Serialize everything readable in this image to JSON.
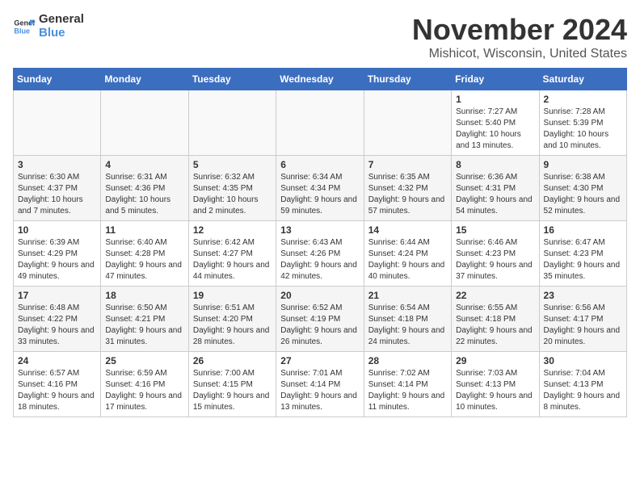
{
  "logo": {
    "line1": "General",
    "line2": "Blue"
  },
  "title": "November 2024",
  "location": "Mishicot, Wisconsin, United States",
  "weekdays": [
    "Sunday",
    "Monday",
    "Tuesday",
    "Wednesday",
    "Thursday",
    "Friday",
    "Saturday"
  ],
  "weeks": [
    [
      {
        "day": "",
        "info": ""
      },
      {
        "day": "",
        "info": ""
      },
      {
        "day": "",
        "info": ""
      },
      {
        "day": "",
        "info": ""
      },
      {
        "day": "",
        "info": ""
      },
      {
        "day": "1",
        "info": "Sunrise: 7:27 AM\nSunset: 5:40 PM\nDaylight: 10 hours and 13 minutes."
      },
      {
        "day": "2",
        "info": "Sunrise: 7:28 AM\nSunset: 5:39 PM\nDaylight: 10 hours and 10 minutes."
      }
    ],
    [
      {
        "day": "3",
        "info": "Sunrise: 6:30 AM\nSunset: 4:37 PM\nDaylight: 10 hours and 7 minutes."
      },
      {
        "day": "4",
        "info": "Sunrise: 6:31 AM\nSunset: 4:36 PM\nDaylight: 10 hours and 5 minutes."
      },
      {
        "day": "5",
        "info": "Sunrise: 6:32 AM\nSunset: 4:35 PM\nDaylight: 10 hours and 2 minutes."
      },
      {
        "day": "6",
        "info": "Sunrise: 6:34 AM\nSunset: 4:34 PM\nDaylight: 9 hours and 59 minutes."
      },
      {
        "day": "7",
        "info": "Sunrise: 6:35 AM\nSunset: 4:32 PM\nDaylight: 9 hours and 57 minutes."
      },
      {
        "day": "8",
        "info": "Sunrise: 6:36 AM\nSunset: 4:31 PM\nDaylight: 9 hours and 54 minutes."
      },
      {
        "day": "9",
        "info": "Sunrise: 6:38 AM\nSunset: 4:30 PM\nDaylight: 9 hours and 52 minutes."
      }
    ],
    [
      {
        "day": "10",
        "info": "Sunrise: 6:39 AM\nSunset: 4:29 PM\nDaylight: 9 hours and 49 minutes."
      },
      {
        "day": "11",
        "info": "Sunrise: 6:40 AM\nSunset: 4:28 PM\nDaylight: 9 hours and 47 minutes."
      },
      {
        "day": "12",
        "info": "Sunrise: 6:42 AM\nSunset: 4:27 PM\nDaylight: 9 hours and 44 minutes."
      },
      {
        "day": "13",
        "info": "Sunrise: 6:43 AM\nSunset: 4:26 PM\nDaylight: 9 hours and 42 minutes."
      },
      {
        "day": "14",
        "info": "Sunrise: 6:44 AM\nSunset: 4:24 PM\nDaylight: 9 hours and 40 minutes."
      },
      {
        "day": "15",
        "info": "Sunrise: 6:46 AM\nSunset: 4:23 PM\nDaylight: 9 hours and 37 minutes."
      },
      {
        "day": "16",
        "info": "Sunrise: 6:47 AM\nSunset: 4:23 PM\nDaylight: 9 hours and 35 minutes."
      }
    ],
    [
      {
        "day": "17",
        "info": "Sunrise: 6:48 AM\nSunset: 4:22 PM\nDaylight: 9 hours and 33 minutes."
      },
      {
        "day": "18",
        "info": "Sunrise: 6:50 AM\nSunset: 4:21 PM\nDaylight: 9 hours and 31 minutes."
      },
      {
        "day": "19",
        "info": "Sunrise: 6:51 AM\nSunset: 4:20 PM\nDaylight: 9 hours and 28 minutes."
      },
      {
        "day": "20",
        "info": "Sunrise: 6:52 AM\nSunset: 4:19 PM\nDaylight: 9 hours and 26 minutes."
      },
      {
        "day": "21",
        "info": "Sunrise: 6:54 AM\nSunset: 4:18 PM\nDaylight: 9 hours and 24 minutes."
      },
      {
        "day": "22",
        "info": "Sunrise: 6:55 AM\nSunset: 4:18 PM\nDaylight: 9 hours and 22 minutes."
      },
      {
        "day": "23",
        "info": "Sunrise: 6:56 AM\nSunset: 4:17 PM\nDaylight: 9 hours and 20 minutes."
      }
    ],
    [
      {
        "day": "24",
        "info": "Sunrise: 6:57 AM\nSunset: 4:16 PM\nDaylight: 9 hours and 18 minutes."
      },
      {
        "day": "25",
        "info": "Sunrise: 6:59 AM\nSunset: 4:16 PM\nDaylight: 9 hours and 17 minutes."
      },
      {
        "day": "26",
        "info": "Sunrise: 7:00 AM\nSunset: 4:15 PM\nDaylight: 9 hours and 15 minutes."
      },
      {
        "day": "27",
        "info": "Sunrise: 7:01 AM\nSunset: 4:14 PM\nDaylight: 9 hours and 13 minutes."
      },
      {
        "day": "28",
        "info": "Sunrise: 7:02 AM\nSunset: 4:14 PM\nDaylight: 9 hours and 11 minutes."
      },
      {
        "day": "29",
        "info": "Sunrise: 7:03 AM\nSunset: 4:13 PM\nDaylight: 9 hours and 10 minutes."
      },
      {
        "day": "30",
        "info": "Sunrise: 7:04 AM\nSunset: 4:13 PM\nDaylight: 9 hours and 8 minutes."
      }
    ]
  ]
}
